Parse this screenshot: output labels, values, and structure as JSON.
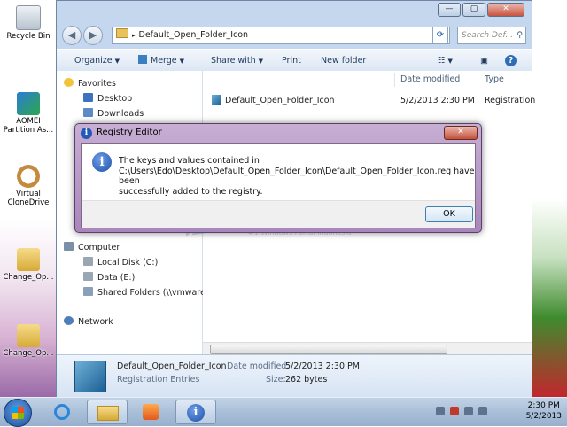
{
  "desktop": {
    "icons": [
      {
        "label": "Recycle Bin"
      },
      {
        "label": "AOMEI Partition As..."
      },
      {
        "label": "Virtual CloneDrive"
      },
      {
        "label": "Change_Op..."
      },
      {
        "label": "Change_Op..."
      }
    ]
  },
  "explorer": {
    "title_buttons": {
      "minimize": "—",
      "maximize": "▢",
      "close": "✕"
    },
    "address": "Default_Open_Folder_Icon",
    "search_placeholder": "Search Def...",
    "toolbar": {
      "organize": "Organize",
      "merge": "Merge",
      "share_with": "Share with",
      "print": "Print",
      "new_folder": "New folder"
    },
    "nav": {
      "favorites": "Favorites",
      "desktop": "Desktop",
      "downloads": "Downloads",
      "computer": "Computer",
      "local_disk": "Local Disk (C:)",
      "data": "Data (E:)",
      "shared": "Shared Folders (\\\\vmware-h",
      "network": "Network"
    },
    "columns": {
      "date_modified": "Date modified",
      "type": "Type"
    },
    "files": [
      {
        "name": "Default_Open_Folder_Icon",
        "date": "5/2/2013 2:30 PM",
        "type": "Registration"
      }
    ],
    "details": {
      "name": "Default_Open_Folder_Icon",
      "kind": "Registration Entries",
      "date_label": "Date modified:",
      "date_value": "5/2/2013 2:30 PM",
      "size_label": "Size:",
      "size_value": "262 bytes"
    }
  },
  "watermark": {
    "word": "WinPoin",
    "tagline": "#1 Windows Portal Indonesia"
  },
  "dialog": {
    "title": "Registry Editor",
    "close": "✕",
    "message": "The keys and values contained in\nC:\\Users\\Edo\\Desktop\\Default_Open_Folder_Icon\\Default_Open_Folder_Icon.reg have been\nsuccessfully added to the registry.",
    "ok": "OK"
  },
  "taskbar": {
    "time": "2:30 PM",
    "date": "5/2/2013"
  },
  "colors": {
    "accent": "#2459b9",
    "dialog_frame": "#a886bb"
  }
}
